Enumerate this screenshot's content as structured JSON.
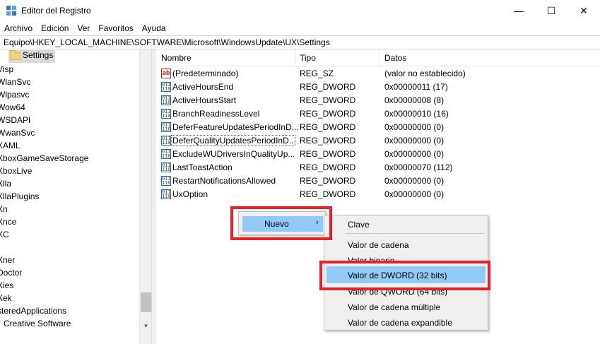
{
  "window": {
    "title": "Editor del Registro",
    "minimize": "—",
    "maximize": "☐",
    "close": "✕"
  },
  "menu": [
    "Archivo",
    "Edición",
    "Ver",
    "Favoritos",
    "Ayuda"
  ],
  "address": "Equipo\\HKEY_LOCAL_MACHINE\\SOFTWARE\\Microsoft\\WindowsUpdate\\UX\\Settings",
  "tree": {
    "selected": "Settings",
    "items": [
      "Visp",
      "WlanSvc",
      "Wlpasvc",
      "Wow64",
      "WSDAPI",
      "WwanSvc",
      "XAML",
      "XboxGameSaveStorage",
      "XboxLive",
      "Xlla",
      "XllaPlugins",
      "Xn",
      "Xnce",
      "XC",
      "",
      "Xner",
      "Doctor",
      "Xies",
      "Xek",
      "steredApplications",
      "Creative Software"
    ]
  },
  "list": {
    "headers": {
      "name": "Nombre",
      "type": "Tipo",
      "data": "Datos"
    },
    "rows": [
      {
        "icon": "string-value-icon",
        "name": "(Predeterminado)",
        "type": "REG_SZ",
        "data": "(valor no establecido)"
      },
      {
        "icon": "binary-value-icon",
        "name": "ActiveHoursEnd",
        "type": "REG_DWORD",
        "data": "0x00000011 (17)"
      },
      {
        "icon": "binary-value-icon",
        "name": "ActiveHoursStart",
        "type": "REG_DWORD",
        "data": "0x00000008 (8)"
      },
      {
        "icon": "binary-value-icon",
        "name": "BranchReadinessLevel",
        "type": "REG_DWORD",
        "data": "0x00000010 (16)"
      },
      {
        "icon": "binary-value-icon",
        "name": "DeferFeatureUpdatesPeriodInD...",
        "type": "REG_DWORD",
        "data": "0x00000000 (0)"
      },
      {
        "icon": "binary-value-icon",
        "name": "DeferQualityUpdatesPeriodInD...",
        "type": "REG_DWORD",
        "data": "0x00000000 (0)"
      },
      {
        "icon": "binary-value-icon",
        "name": "ExcludeWUDriversInQualityUp...",
        "type": "REG_DWORD",
        "data": "0x00000000 (0)"
      },
      {
        "icon": "binary-value-icon",
        "name": "LastToastAction",
        "type": "REG_DWORD",
        "data": "0x00000070 (112)"
      },
      {
        "icon": "binary-value-icon",
        "name": "RestartNotificationsAllowed",
        "type": "REG_DWORD",
        "data": "0x00000000 (0)"
      },
      {
        "icon": "binary-value-icon",
        "name": "UxOption",
        "type": "REG_DWORD",
        "data": "0x00000000 (0)"
      }
    ]
  },
  "context_menu": {
    "parent_label": "Nuevo",
    "parent_arrow": "›",
    "submenu": [
      "Clave",
      "Valor de cadena",
      "Valor binario",
      "Valor de DWORD (32 bits)",
      "Valor de QWORD (64 bits)",
      "Valor de cadena múltiple",
      "Valor de cadena expandible"
    ]
  },
  "icons": {
    "string": "ab",
    "binary": "011 110"
  },
  "colors": {
    "highlight": "#91c9f7",
    "annotation": "#e8202a",
    "tree_selected": "#d9d9d9"
  }
}
